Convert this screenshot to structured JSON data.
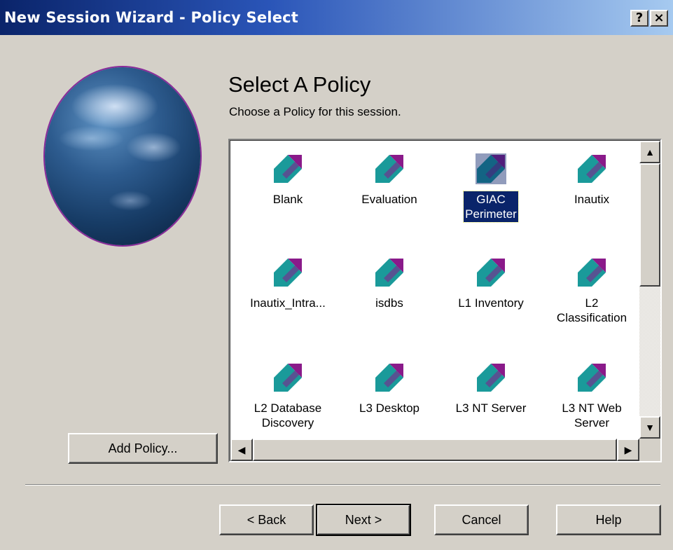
{
  "window": {
    "title": "New Session Wizard - Policy Select",
    "help_glyph": "?",
    "close_glyph": "×"
  },
  "header": {
    "title": "Select A Policy",
    "subtitle": "Choose a Policy for this session."
  },
  "policies": [
    {
      "label": "Blank",
      "selected": false
    },
    {
      "label": "Evaluation",
      "selected": false
    },
    {
      "label": "GIAC\nPerimeter",
      "selected": true
    },
    {
      "label": "Inautix",
      "selected": false
    },
    {
      "label": "Inautix_Intra...",
      "selected": false
    },
    {
      "label": "isdbs",
      "selected": false
    },
    {
      "label": "L1 Inventory",
      "selected": false
    },
    {
      "label": "L2\nClassification",
      "selected": false
    },
    {
      "label": "L2 Database\nDiscovery",
      "selected": false
    },
    {
      "label": "L3 Desktop",
      "selected": false
    },
    {
      "label": "L3 NT Server",
      "selected": false
    },
    {
      "label": "L3 NT Web\nServer",
      "selected": false
    }
  ],
  "buttons": {
    "add_policy": "Add Policy...",
    "back": "< Back",
    "next": "Next >",
    "cancel": "Cancel",
    "help": "Help"
  },
  "icons": {
    "policy": "policy-arrow-icon",
    "scroll_up": "▲",
    "scroll_down": "▼",
    "scroll_left": "◀",
    "scroll_right": "▶"
  },
  "colors": {
    "dialog_bg": "#d4d0c8",
    "title_start": "#0a246a",
    "title_end": "#a6caf0",
    "selection": "#0a246a",
    "icon_teal": "#1a9a9a",
    "icon_purple": "#8a1a8a"
  }
}
